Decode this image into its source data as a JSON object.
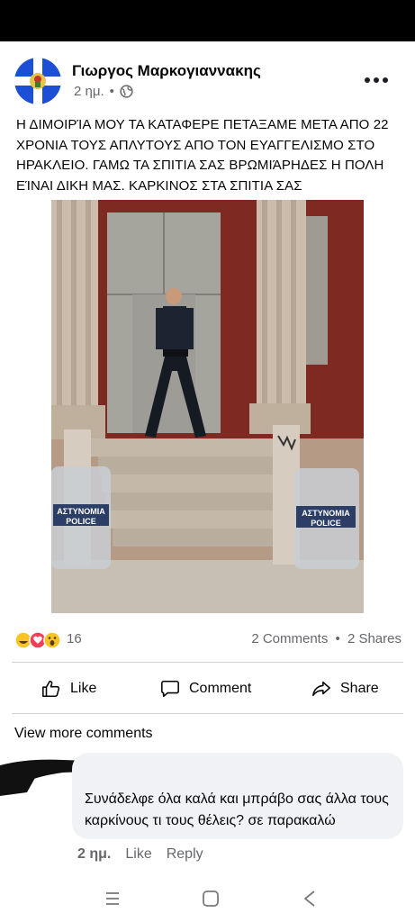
{
  "post": {
    "author": "Γιωργος Μαρκογιαννακης",
    "time": "2 ημ.",
    "separator": "•",
    "text": "Η ΔΙΜΟΙΡΊΑ ΜΟΥ ΤΑ ΚΑΤΑΦΕΡΕ ΠΕΤΑΞΑΜΕ ΜΕΤΑ ΑΠΟ 22 ΧΡΟΝΙΑ ΤΟΥΣ ΑΠΛΥΤΟΥΣ ΑΠΟ ΤΟΝ ΕΥΑΓΓΕΛΙΣΜΟ ΣΤΟ ΗΡΑΚΛΕΙΟ. ΓΑΜΩ ΤΑ ΣΠΙΤΙΑ ΣΑΣ ΒΡΩΜΙΆΡΗΔΕΣ Η ΠΟΛΗ ΕΊΝΑΙ ΔΙΚΗ ΜΑΣ. ΚΑΡΚΙΝΟΣ ΣΤΑ ΣΠΙΤΙΑ ΣΑΣ",
    "photo_shield_text_1": "ΑΣΤΥΝΟΜΙΑ",
    "photo_shield_text_2": "POLICE",
    "icons": {
      "privacy": "globe-icon",
      "more": "more-dots-icon"
    }
  },
  "reactions": {
    "count": "16",
    "comments": "2 Comments",
    "dot": "•",
    "shares": "2 Shares",
    "icons": [
      "haha-icon",
      "love-icon",
      "wow-icon"
    ]
  },
  "actions": {
    "like": "Like",
    "comment": "Comment",
    "share": "Share"
  },
  "comments": {
    "view_more": "View more comments",
    "items": [
      {
        "text": "Συνάδελφε όλα καλά και μπράβο σας άλλα τους καρκίνους τι τους θέλεις? σε παρακαλώ",
        "time": "2 ημ.",
        "like": "Like",
        "reply": "Reply"
      }
    ]
  },
  "colors": {
    "secondary_text": "#65676b",
    "bubble": "#f0f2f5",
    "divider": "#ced0d4"
  }
}
